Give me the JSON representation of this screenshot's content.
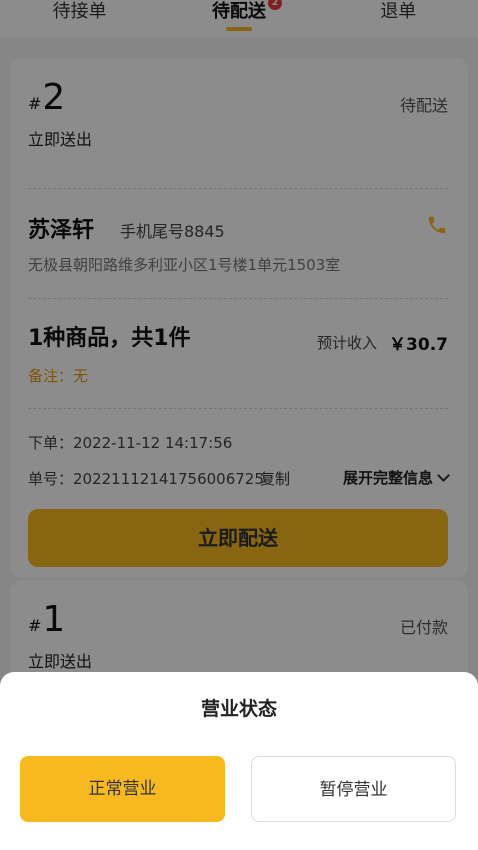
{
  "tabs": [
    {
      "label": "待接单"
    },
    {
      "label": "待配送",
      "badge": "2"
    },
    {
      "label": "退单"
    }
  ],
  "orders": [
    {
      "hash": "#",
      "number": "2",
      "status": "待配送",
      "delivery_type": "立即送出",
      "customer_name": "苏泽轩",
      "phone_tail": "手机尾号8845",
      "address": "无极县朝阳路维多利亚小区1号楼1单元1503室",
      "goods_summary": "1种商品，共1件",
      "income_label": "预计收入",
      "income_value": "￥30.7",
      "remark": "备注：无",
      "order_time": "下单：2022-11-12 14:17:56",
      "order_id": "单号：20221112141756006725",
      "copy_label": "复制",
      "expand_label": "展开完整信息",
      "action_label": "立即配送"
    },
    {
      "hash": "#",
      "number": "1",
      "status": "已付款",
      "delivery_type": "立即送出"
    }
  ],
  "sheet": {
    "title": "营业状态",
    "open_label": "正常营业",
    "pause_label": "暂停营业"
  },
  "colors": {
    "accent": "#f8b920",
    "badge": "#e53b3b",
    "remark": "#e89a10"
  },
  "icons": {
    "phone": "phone-icon",
    "expand": "chevron-down-icon"
  }
}
